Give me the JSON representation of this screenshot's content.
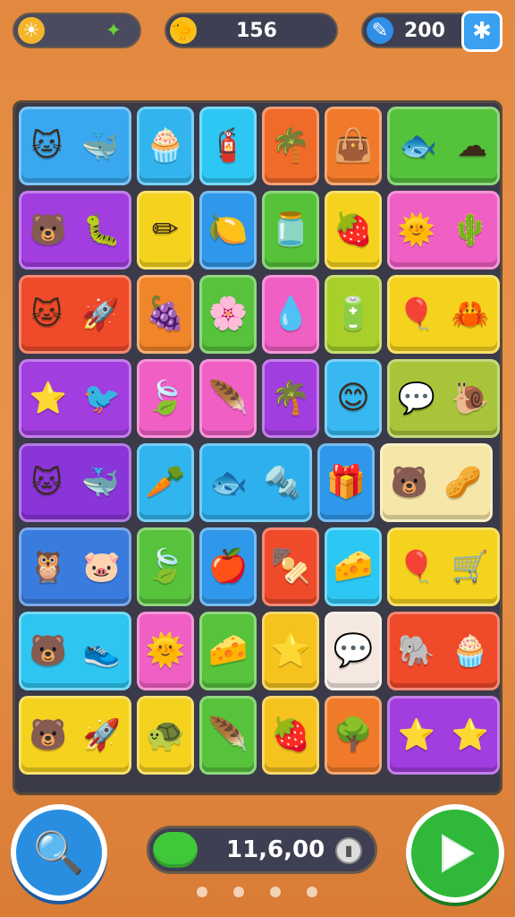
{
  "hud": {
    "energy_icon": "sun-icon",
    "bonus_icon": "leaf-icon",
    "bird_icon": "bird-icon",
    "coin_count": "156",
    "gem_icon": "feather-icon",
    "gem_count": "200",
    "puzzle_icon": "puzzle-icon"
  },
  "board": {
    "rows": [
      [
        {
          "span": 2,
          "color": "#3aa8f0",
          "icons": [
            "cat-icon",
            "whale-icon"
          ]
        },
        {
          "span": 1,
          "color": "#32b5ee",
          "icons": [
            "cupcake-icon"
          ]
        },
        {
          "span": 1,
          "color": "#2dc7f3",
          "icons": [
            "hydrant-icon"
          ]
        },
        {
          "span": 1,
          "color": "#f06a2a",
          "icons": [
            "palm-icon"
          ]
        },
        {
          "span": 1,
          "color": "#f07a2a",
          "icons": [
            "bag-icon"
          ]
        },
        {
          "span": 2,
          "color": "#55c23c",
          "icons": [
            "fish-icon",
            "cloud-icon"
          ]
        }
      ],
      [
        {
          "span": 2,
          "color": "#a23de0",
          "icons": [
            "bear-icon",
            "bug-icon"
          ]
        },
        {
          "span": 1,
          "color": "#f5d21e",
          "icons": [
            "pencil-icon"
          ]
        },
        {
          "span": 1,
          "color": "#2f98ea",
          "icons": [
            "lemon-icon"
          ]
        },
        {
          "span": 1,
          "color": "#56c23a",
          "icons": [
            "jar-icon"
          ]
        },
        {
          "span": 1,
          "color": "#f5d21e",
          "icons": [
            "strawberry-icon"
          ]
        },
        {
          "span": 2,
          "color": "#f05fc4",
          "icons": [
            "sun-icon",
            "cactus-icon"
          ]
        }
      ],
      [
        {
          "span": 2,
          "color": "#ef4a2a",
          "icons": [
            "cat-icon",
            "rocket-icon"
          ]
        },
        {
          "span": 1,
          "color": "#f0852a",
          "icons": [
            "berries-icon"
          ]
        },
        {
          "span": 1,
          "color": "#57c23c",
          "icons": [
            "flower-icon"
          ]
        },
        {
          "span": 1,
          "color": "#f05fc4",
          "icons": [
            "drop-icon"
          ]
        },
        {
          "span": 1,
          "color": "#a8cf2a",
          "icons": [
            "battery-icon"
          ]
        },
        {
          "span": 2,
          "color": "#f5d21e",
          "icons": [
            "balloon-icon",
            "crab-icon"
          ]
        }
      ],
      [
        {
          "span": 2,
          "color": "#a23de0",
          "icons": [
            "star-icon",
            "bird-icon"
          ]
        },
        {
          "span": 1,
          "color": "#f05fc4",
          "icons": [
            "leaf-icon"
          ]
        },
        {
          "span": 1,
          "color": "#f05fc4",
          "icons": [
            "feather-icon"
          ]
        },
        {
          "span": 1,
          "color": "#a23de0",
          "icons": [
            "palm-icon"
          ]
        },
        {
          "span": 1,
          "color": "#38b8f0",
          "icons": [
            "smiley-icon"
          ]
        },
        {
          "span": 2,
          "color": "#a8c43a",
          "icons": [
            "chat-icon",
            "snail-icon"
          ]
        }
      ],
      [
        {
          "span": 2,
          "color": "#8a35d8",
          "icons": [
            "cat-icon",
            "whale-icon"
          ]
        },
        {
          "span": 1,
          "color": "#30b5ee",
          "icons": [
            "carrot-icon"
          ]
        },
        {
          "span": 2,
          "color": "#2fb0ee",
          "icons": [
            "fish-icon",
            "drill-icon"
          ]
        },
        {
          "span": 1,
          "color": "#2f98ea",
          "icons": [
            "gift-icon"
          ]
        },
        {
          "span": 2,
          "color": "#f6e6a8",
          "icons": [
            "bear-icon",
            "peanut-icon"
          ]
        }
      ],
      [
        {
          "span": 2,
          "color": "#3a7cde",
          "icons": [
            "owl-icon",
            "pig-icon"
          ]
        },
        {
          "span": 1,
          "color": "#57c23c",
          "icons": [
            "leaf-icon"
          ]
        },
        {
          "span": 1,
          "color": "#2f98ea",
          "icons": [
            "apple-icon"
          ]
        },
        {
          "span": 1,
          "color": "#ef4a2a",
          "icons": [
            "kebab-icon"
          ]
        },
        {
          "span": 1,
          "color": "#2dc7f3",
          "icons": [
            "cheese-icon"
          ]
        },
        {
          "span": 2,
          "color": "#f5d21e",
          "icons": [
            "balloon-icon",
            "cart-icon"
          ]
        }
      ],
      [
        {
          "span": 2,
          "color": "#2ec5f0",
          "icons": [
            "bear-icon",
            "shoe-icon"
          ]
        },
        {
          "span": 1,
          "color": "#f05fc4",
          "icons": [
            "sun-icon"
          ]
        },
        {
          "span": 1,
          "color": "#57c23c",
          "icons": [
            "cheese-icon"
          ]
        },
        {
          "span": 1,
          "color": "#f5c21e",
          "icons": [
            "star-icon"
          ]
        },
        {
          "span": 1,
          "color": "#f5e8e0",
          "icons": [
            "chat-icon"
          ]
        },
        {
          "span": 2,
          "color": "#ef4a2a",
          "icons": [
            "elephant-icon",
            "cupcake-icon"
          ]
        }
      ],
      [
        {
          "span": 2,
          "color": "#f5d21e",
          "icons": [
            "bear-icon",
            "rocket-icon"
          ]
        },
        {
          "span": 1,
          "color": "#f5d21e",
          "icons": [
            "turtle-icon"
          ]
        },
        {
          "span": 1,
          "color": "#57c23c",
          "icons": [
            "feather-icon"
          ]
        },
        {
          "span": 1,
          "color": "#f5c21e",
          "icons": [
            "strawberry-icon"
          ]
        },
        {
          "span": 1,
          "color": "#f07a2a",
          "icons": [
            "tree-icon"
          ]
        },
        {
          "span": 2,
          "color": "#a23de0",
          "icons": [
            "star-icon",
            "star-icon"
          ]
        }
      ]
    ]
  },
  "footer": {
    "hint_icon": "magnifier-icon",
    "progress_value": "11,6,00",
    "progress_fill": 0.2,
    "coin_icon": "coin-icon",
    "play_icon": "play-icon",
    "page_dots": 4
  },
  "glyphs": {
    "cat-icon": "🐱",
    "whale-icon": "🐳",
    "cupcake-icon": "🧁",
    "hydrant-icon": "🧯",
    "palm-icon": "🌴",
    "bag-icon": "👜",
    "fish-icon": "🐟",
    "cloud-icon": "☁",
    "bear-icon": "🐻",
    "bug-icon": "🐛",
    "pencil-icon": "✏",
    "lemon-icon": "🍋",
    "jar-icon": "🫙",
    "strawberry-icon": "🍓",
    "sun-icon": "🌞",
    "cactus-icon": "🌵",
    "rocket-icon": "🚀",
    "berries-icon": "🍇",
    "flower-icon": "🌸",
    "drop-icon": "💧",
    "battery-icon": "🔋",
    "balloon-icon": "🎈",
    "crab-icon": "🦀",
    "star-icon": "⭐",
    "bird-icon": "🐦",
    "leaf-icon": "🍃",
    "feather-icon": "🪶",
    "smiley-icon": "😊",
    "chat-icon": "💬",
    "snail-icon": "🐌",
    "carrot-icon": "🥕",
    "drill-icon": "🔩",
    "gift-icon": "🎁",
    "peanut-icon": "🥜",
    "owl-icon": "🦉",
    "pig-icon": "🐷",
    "apple-icon": "🍎",
    "kebab-icon": "🍢",
    "cheese-icon": "🧀",
    "cart-icon": "🛒",
    "shoe-icon": "👟",
    "elephant-icon": "🐘",
    "turtle-icon": "🐢",
    "tree-icon": "🌳"
  }
}
